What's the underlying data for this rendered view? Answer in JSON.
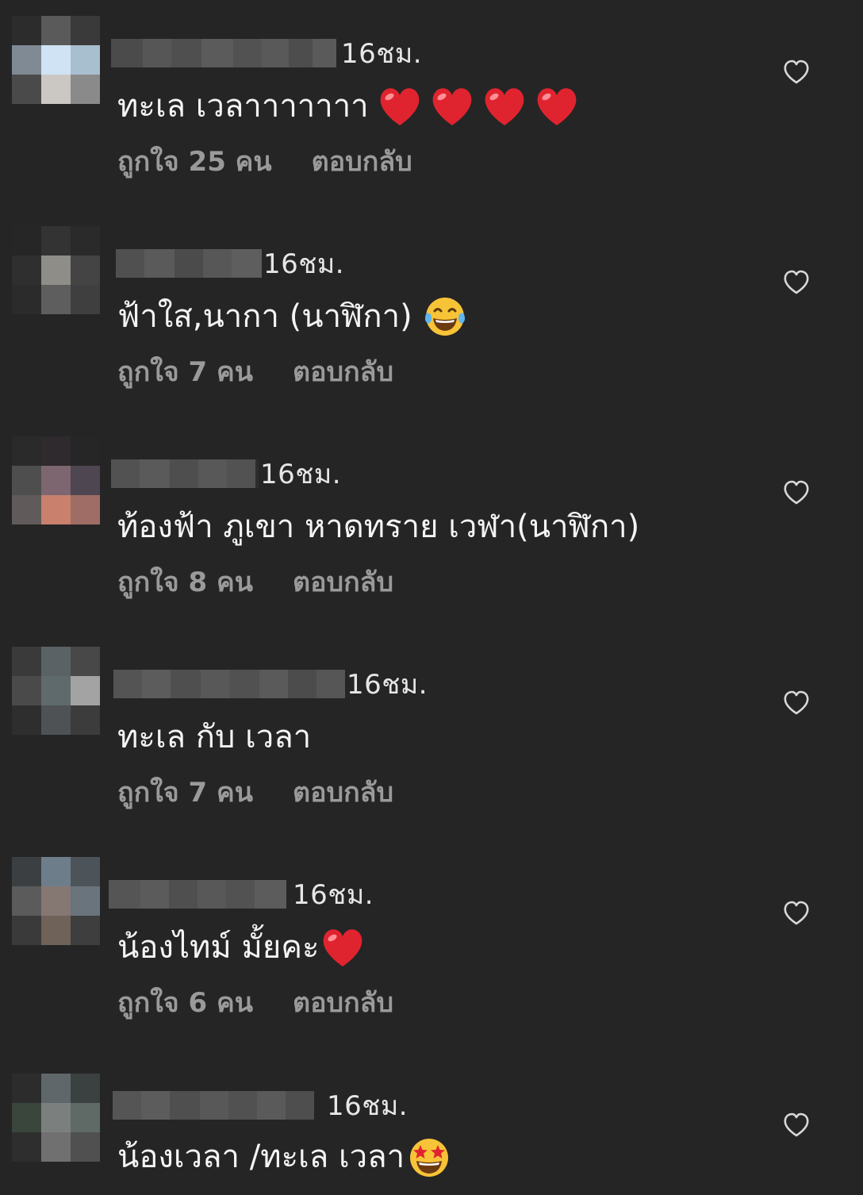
{
  "comments": [
    {
      "time": "16ชม.",
      "text": "ทะเล เวลาาาาาาา",
      "emojis": [
        "heart",
        "heart",
        "heart",
        "heart"
      ],
      "likes": "ถูกใจ 25 คน",
      "reply": "ตอบกลับ"
    },
    {
      "time": "16ชม.",
      "text": "ฟ้าใส,นากา (นาฬิกา)",
      "emojis": [
        "tears-of-joy"
      ],
      "likes": "ถูกใจ 7 คน",
      "reply": "ตอบกลับ"
    },
    {
      "time": "16ชม.",
      "text": "ท้องฟ้า ภูเขา หาดทราย เวฬา(นาฬิกา)",
      "emojis": [],
      "likes": "ถูกใจ 8 คน",
      "reply": "ตอบกลับ"
    },
    {
      "time": "16ชม.",
      "text": "ทะเล กับ เวลา",
      "emojis": [],
      "likes": "ถูกใจ 7 คน",
      "reply": "ตอบกลับ"
    },
    {
      "time": "16ชม.",
      "text": "น้องไทม์ มั้ยคะ",
      "emojis": [
        "heart"
      ],
      "likes": "ถูกใจ 6 คน",
      "reply": "ตอบกลับ"
    },
    {
      "time": "16ชม.",
      "text": "น้องเวลา /ทะเล เวลา",
      "emojis": [
        "star-struck"
      ],
      "likes": "",
      "reply": ""
    }
  ],
  "icons": {
    "like": "heart-outline-icon",
    "heart_emoji_color": "#e0242f",
    "emoji_face_color": "#f7c337"
  },
  "colors": {
    "background": "#252525",
    "text": "#f4f4f4",
    "meta": "#9a9a9a"
  }
}
